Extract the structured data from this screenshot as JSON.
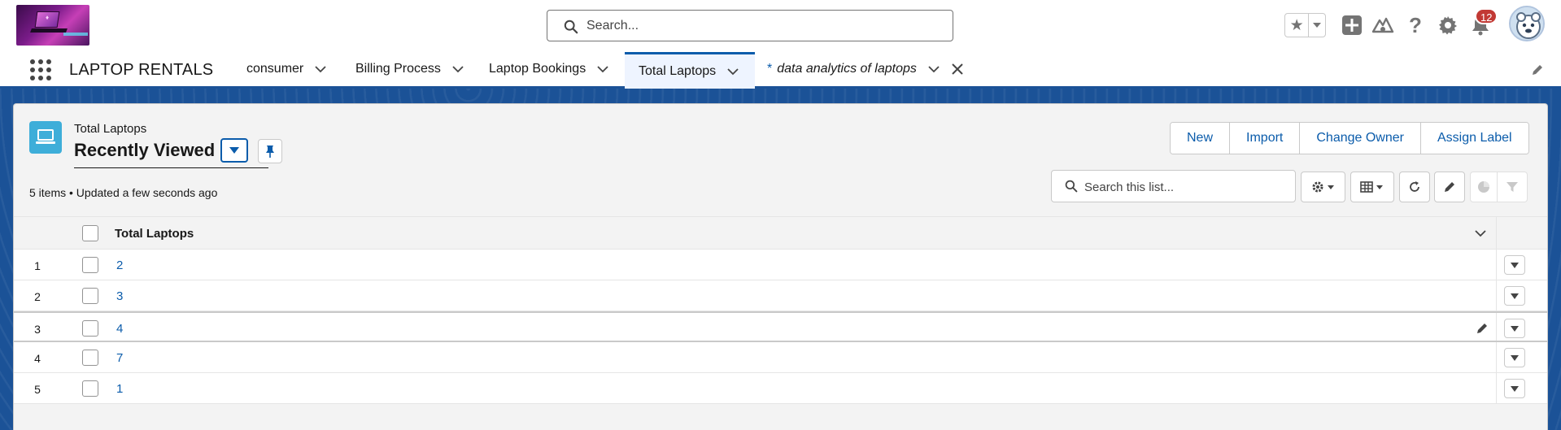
{
  "global_search": {
    "placeholder": "Search..."
  },
  "notifications": {
    "count": "12"
  },
  "nav": {
    "app_name": "LAPTOP RENTALS",
    "tabs": [
      {
        "label": "consumer"
      },
      {
        "label": "Billing Process"
      },
      {
        "label": "Laptop Bookings"
      },
      {
        "label": "Total Laptops",
        "active": true
      },
      {
        "label": "data analytics of laptops",
        "unsaved_marker": "*"
      }
    ]
  },
  "list_view": {
    "object_label": "Total Laptops",
    "view_name": "Recently Viewed",
    "status": "5 items • Updated a few seconds ago",
    "actions": [
      "New",
      "Import",
      "Change Owner",
      "Assign Label"
    ],
    "search_placeholder": "Search this list..."
  },
  "table": {
    "column_header": "Total Laptops",
    "rows": [
      {
        "num": "1",
        "value": "2"
      },
      {
        "num": "2",
        "value": "3"
      },
      {
        "num": "3",
        "value": "4"
      },
      {
        "num": "4",
        "value": "7"
      },
      {
        "num": "5",
        "value": "1"
      }
    ]
  },
  "colors": {
    "brand": "#0b5cab",
    "band": "#1b5297",
    "object_icon": "#3eaed9",
    "badge": "#c23934"
  }
}
